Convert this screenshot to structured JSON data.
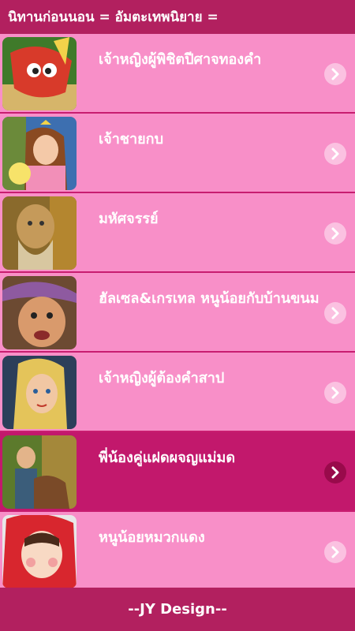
{
  "header": {
    "title": "นิทานก่อนนอน = อัมตะเทพนิยาย ="
  },
  "items": [
    {
      "title": "เจ้าหญิงผู้พิชิตปีศาจทองคำ",
      "thumb": "princess-golden-demon-thumbnail"
    },
    {
      "title": "เจ้าชายกบ",
      "thumb": "frog-prince-thumbnail"
    },
    {
      "title": "มหัศจรรย์",
      "thumb": "old-man-thumbnail"
    },
    {
      "title": "ฮัลเซล&เกรเทล หนูน้อยกับบ้านขนม",
      "thumb": "witch-thumbnail"
    },
    {
      "title": "เจ้าหญิงผู้ต้องคำสาป",
      "thumb": "cursed-princess-thumbnail"
    },
    {
      "title": "พี่น้องคู่แฝดผจญแม่มด",
      "thumb": "twins-thumbnail"
    },
    {
      "title": "หนูน้อยหมวกแดง",
      "thumb": "red-riding-hood-thumbnail"
    }
  ],
  "selected_index": 5,
  "footer": {
    "text": "--JY Design--"
  },
  "colors": {
    "bar": "#b2205f",
    "background": "#f88fc8",
    "selected": "#c2186c",
    "divider": "#c81d70"
  },
  "icons": {
    "chevron": "chevron-right-icon"
  }
}
